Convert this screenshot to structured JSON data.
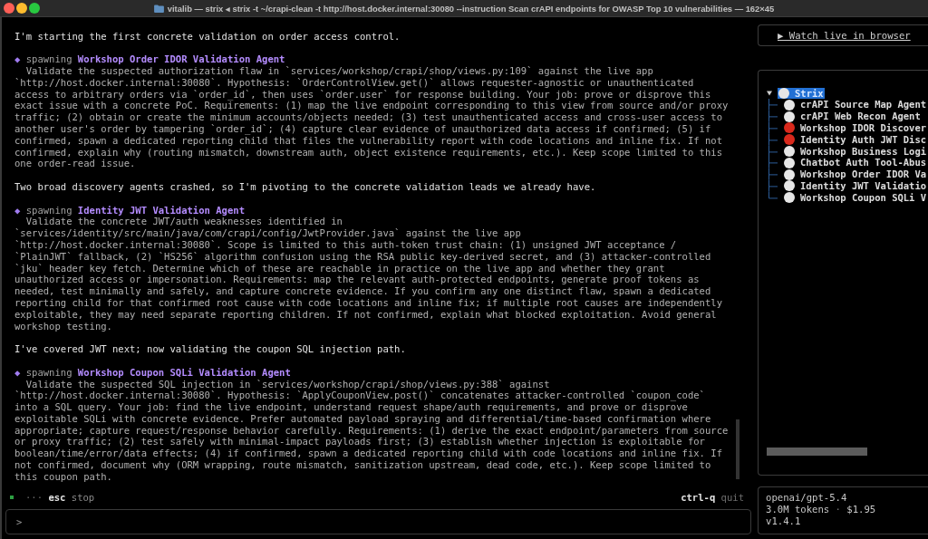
{
  "window": {
    "title": "vitalib — strix ◂ strix -t ~/crapi-clean -t http://host.docker.internal:30080 --instruction Scan crAPI endpoints for OWASP Top 10 vulnerabilities — 162×45"
  },
  "log": [
    {
      "kind": "message",
      "text": "I'm starting the first concrete validation on order access control."
    },
    {
      "kind": "spawn",
      "marker": "◆",
      "verb": "spawning",
      "agent": "Workshop Order IDOR Validation Agent",
      "instructions": "Validate the suspected authorization flaw in `services/workshop/crapi/shop/views.py:109` against the live app `http://host.docker.internal:30080`. Hypothesis: `OrderControlView.get()` allows requester-agnostic or unauthenticated access to arbitrary orders via `order_id`, then uses `order.user` for response building. Your job: prove or disprove this exact issue with a concrete PoC. Requirements: (1) map the live endpoint corresponding to this view from source and/or proxy traffic; (2) obtain or create the minimum accounts/objects needed; (3) test unauthenticated access and cross-user access to another user's order by tampering `order_id`; (4) capture clear evidence of unauthorized data access if confirmed; (5) if confirmed, spawn a dedicated reporting child that files the vulnerability report with code locations and inline fix. If not confirmed, explain why (routing mismatch, downstream auth, object existence requirements, etc.). Keep scope limited to this one order-read issue."
    },
    {
      "kind": "message",
      "text": "Two broad discovery agents crashed, so I'm pivoting to the concrete validation leads we already have."
    },
    {
      "kind": "spawn",
      "marker": "◆",
      "verb": "spawning",
      "agent": "Identity JWT Validation Agent",
      "instructions": "Validate the concrete JWT/auth weaknesses identified in `services/identity/src/main/java/com/crapi/config/JwtProvider.java` against the live app `http://host.docker.internal:30080`. Scope is limited to this auth-token trust chain: (1) unsigned JWT acceptance / `PlainJWT` fallback, (2) `HS256` algorithm confusion using the RSA public key-derived secret, and (3) attacker-controlled `jku` header key fetch. Determine which of these are reachable in practice on the live app and whether they grant unauthorized access or impersonation. Requirements: map the relevant auth-protected endpoints, generate proof tokens as needed, test minimally and safely, and capture concrete evidence. If you confirm any one distinct flaw, spawn a dedicated reporting child for that confirmed root cause with code locations and inline fix; if multiple root causes are independently exploitable, they may need separate reporting children. If not confirmed, explain what blocked exploitation. Avoid general workshop testing."
    },
    {
      "kind": "message",
      "text": "I've covered JWT next; now validating the coupon SQL injection path."
    },
    {
      "kind": "spawn",
      "marker": "◆",
      "verb": "spawning",
      "agent": "Workshop Coupon SQLi Validation Agent",
      "instructions": "Validate the suspected SQL injection in `services/workshop/crapi/shop/views.py:388` against `http://host.docker.internal:30080`. Hypothesis: `ApplyCouponView.post()` concatenates attacker-controlled `coupon_code` into a SQL query. Your job: find the live endpoint, understand request shape/auth requirements, and prove or disprove exploitable SQLi with concrete evidence. Prefer automated payload spraying and differential/time-based confirmation where appropriate; capture request/response behavior carefully. Requirements: (1) derive the exact endpoint/parameters from source or proxy traffic; (2) test safely with minimal-impact payloads first; (3) establish whether injection is exploitable for boolean/time/error/data effects; (4) if confirmed, spawn a dedicated reporting child with code locations and inline fix. If not confirmed, document why (ORM wrapping, route mismatch, sanitization upstream, dead code, etc.). Keep scope limited to this coupon path."
    }
  ],
  "status_line": {
    "spinner": "···",
    "left_hints": [
      {
        "key": "esc",
        "action": "stop"
      }
    ],
    "right_hints": [
      {
        "key": "ctrl-q",
        "action": "quit"
      }
    ]
  },
  "prompt": {
    "symbol": ">"
  },
  "sidebar": {
    "watch_link": "▶ Watch live in browser",
    "agent_tree": [
      {
        "label": "Strix",
        "color": "#e6e6e6",
        "selected": true,
        "expanded": true,
        "children": [
          {
            "label": "crAPI Source Map Agent",
            "color": "#e6e6e6",
            "selected": false
          },
          {
            "label": "crAPI Web Recon Agent",
            "color": "#e6e6e6",
            "selected": false
          },
          {
            "label": "Workshop IDOR Discover",
            "color": "#d9291c",
            "selected": false
          },
          {
            "label": "Identity Auth JWT Disc",
            "color": "#d9291c",
            "selected": false
          },
          {
            "label": "Workshop Business Logi",
            "color": "#e6e6e6",
            "selected": false
          },
          {
            "label": "Chatbot Auth Tool-Abus",
            "color": "#e6e6e6",
            "selected": false
          },
          {
            "label": "Workshop Order IDOR Va",
            "color": "#e6e6e6",
            "selected": false
          },
          {
            "label": "Identity JWT Validatio",
            "color": "#e6e6e6",
            "selected": false
          },
          {
            "label": "Workshop Coupon SQLi V",
            "color": "#e6e6e6",
            "selected": false
          }
        ]
      }
    ],
    "stats": {
      "model": "openai/gpt-5.4",
      "tokens": "3.0M tokens",
      "separator": "·",
      "cost": "$1.95",
      "version": "v1.4.1"
    }
  }
}
